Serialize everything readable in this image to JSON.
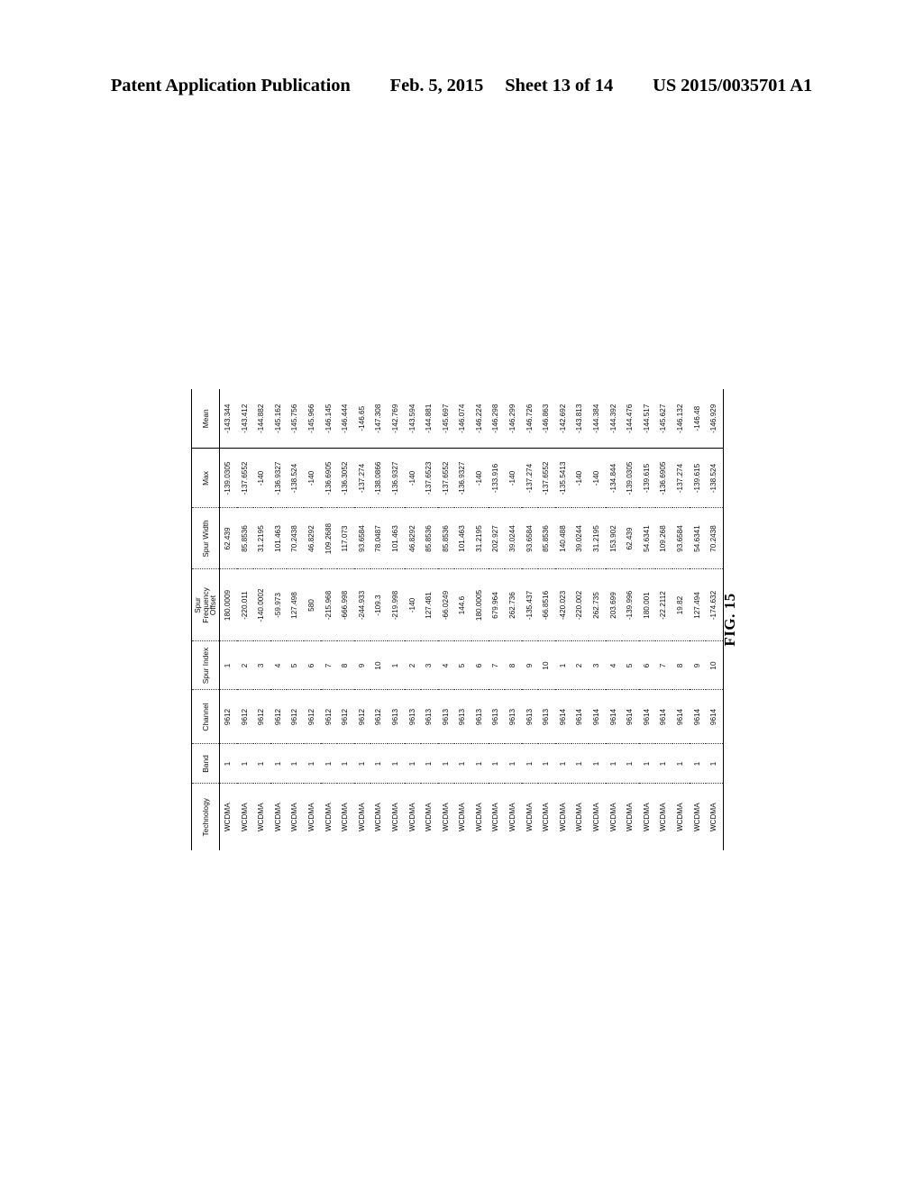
{
  "header": {
    "publication": "Patent Application Publication",
    "date": "Feb. 5, 2015",
    "sheet": "Sheet 13 of 14",
    "patent_number": "US 2015/0035701 A1"
  },
  "figure": {
    "label": "FIG. 15"
  },
  "table": {
    "columns": [
      "Technology",
      "Band",
      "Channel",
      "Spur Index",
      "Spur Frequency Offset",
      "Spur Width",
      "Max",
      "Mean"
    ],
    "column_header_lines": {
      "offset_line1": "Spur",
      "offset_line2": "Frequency",
      "offset_line3": "Offset"
    },
    "rows": [
      [
        "WCDMA",
        "1",
        "9612",
        "1",
        "180.0009",
        "62.439",
        "-139.0305",
        "-143.344"
      ],
      [
        "WCDMA",
        "1",
        "9612",
        "2",
        "-220.011",
        "85.8536",
        "-137.6552",
        "-143.412"
      ],
      [
        "WCDMA",
        "1",
        "9612",
        "3",
        "-140.0002",
        "31.2195",
        "-140",
        "-144.882"
      ],
      [
        "WCDMA",
        "1",
        "9612",
        "4",
        "-59.973",
        "101.463",
        "-136.9327",
        "-145.162"
      ],
      [
        "WCDMA",
        "1",
        "9612",
        "5",
        "127.498",
        "70.2438",
        "-138.524",
        "-145.756"
      ],
      [
        "WCDMA",
        "1",
        "9612",
        "6",
        "580",
        "46.8292",
        "-140",
        "-145.966"
      ],
      [
        "WCDMA",
        "1",
        "9612",
        "7",
        "-215.968",
        "109.2688",
        "-136.6905",
        "-146.145"
      ],
      [
        "WCDMA",
        "1",
        "9612",
        "8",
        "-666.998",
        "117.073",
        "-136.3052",
        "-146.444"
      ],
      [
        "WCDMA",
        "1",
        "9612",
        "9",
        "-244.933",
        "93.6584",
        "-137.274",
        "-146.65"
      ],
      [
        "WCDMA",
        "1",
        "9612",
        "10",
        "-109.3",
        "78.0487",
        "-138.0866",
        "-147.308"
      ],
      [
        "WCDMA",
        "1",
        "9613",
        "1",
        "-219.998",
        "101.463",
        "-136.9327",
        "-142.769"
      ],
      [
        "WCDMA",
        "1",
        "9613",
        "2",
        "-140",
        "46.8292",
        "-140",
        "-143.594"
      ],
      [
        "WCDMA",
        "1",
        "9613",
        "3",
        "127.481",
        "85.8536",
        "-137.6523",
        "-144.881"
      ],
      [
        "WCDMA",
        "1",
        "9613",
        "4",
        "-66.0249",
        "85.8536",
        "-137.6552",
        "-145.697"
      ],
      [
        "WCDMA",
        "1",
        "9613",
        "5",
        "144.6",
        "101.463",
        "-136.9327",
        "-146.074"
      ],
      [
        "WCDMA",
        "1",
        "9613",
        "6",
        "180.0005",
        "31.2195",
        "-140",
        "-146.224"
      ],
      [
        "WCDMA",
        "1",
        "9613",
        "7",
        "679.964",
        "202.927",
        "-133.916",
        "-146.298"
      ],
      [
        "WCDMA",
        "1",
        "9613",
        "8",
        "262.736",
        "39.0244",
        "-140",
        "-146.299"
      ],
      [
        "WCDMA",
        "1",
        "9613",
        "9",
        "-135.437",
        "93.6584",
        "-137.274",
        "-146.726"
      ],
      [
        "WCDMA",
        "1",
        "9613",
        "10",
        "-66.8516",
        "85.8536",
        "-137.6552",
        "-146.863"
      ],
      [
        "WCDMA",
        "1",
        "9614",
        "1",
        "-420.023",
        "140.488",
        "-135.5413",
        "-142.692"
      ],
      [
        "WCDMA",
        "1",
        "9614",
        "2",
        "-220.002",
        "39.0244",
        "-140",
        "-143.813"
      ],
      [
        "WCDMA",
        "1",
        "9614",
        "3",
        "262.735",
        "31.2195",
        "-140",
        "-144.384"
      ],
      [
        "WCDMA",
        "1",
        "9614",
        "4",
        "203.699",
        "153.902",
        "-134.844",
        "-144.392"
      ],
      [
        "WCDMA",
        "1",
        "9614",
        "5",
        "-139.996",
        "62.439",
        "-139.0305",
        "-144.476"
      ],
      [
        "WCDMA",
        "1",
        "9614",
        "6",
        "180.001",
        "54.6341",
        "-139.615",
        "-144.517"
      ],
      [
        "WCDMA",
        "1",
        "9614",
        "7",
        "-22.2112",
        "109.268",
        "-136.6905",
        "-145.627"
      ],
      [
        "WCDMA",
        "1",
        "9614",
        "8",
        "19.82",
        "93.6584",
        "-137.274",
        "-146.132"
      ],
      [
        "WCDMA",
        "1",
        "9614",
        "9",
        "127.494",
        "54.6341",
        "-139.615",
        "-146.48"
      ],
      [
        "WCDMA",
        "1",
        "9614",
        "10",
        "-174.632",
        "70.2438",
        "-138.524",
        "-146.929"
      ]
    ]
  }
}
